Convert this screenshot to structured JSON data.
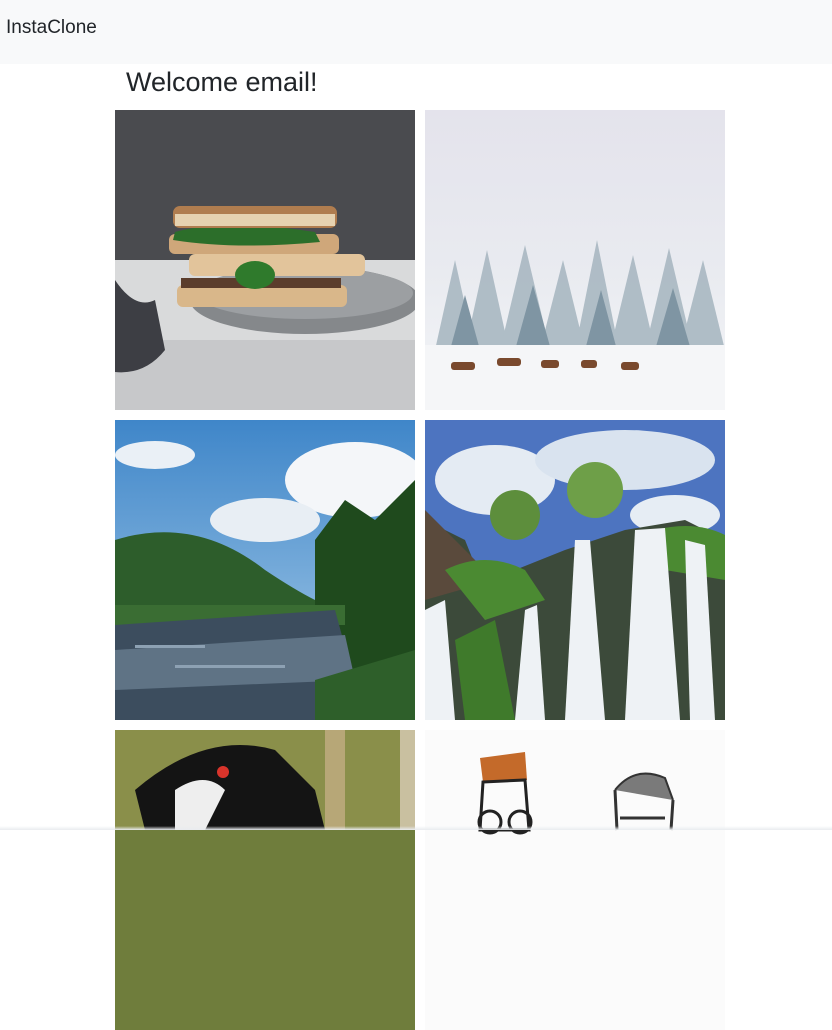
{
  "navbar": {
    "brand": "InstaClone"
  },
  "feed": {
    "heading": "Welcome email!",
    "posts": [
      {
        "icon": "sandwich-photo",
        "description": "food"
      },
      {
        "icon": "snowy-forest-deer-photo",
        "description": "winter"
      },
      {
        "icon": "river-landscape-photo",
        "description": "river"
      },
      {
        "icon": "waterfall-photo",
        "description": "waterfall"
      },
      {
        "icon": "dog-photo",
        "description": "dog"
      },
      {
        "icon": "cartoon-sketch-photo",
        "description": "sketch"
      }
    ]
  },
  "colors": {
    "navbar_bg": "#f8f9fa",
    "text": "#212529",
    "page_bg": "#ffffff"
  }
}
